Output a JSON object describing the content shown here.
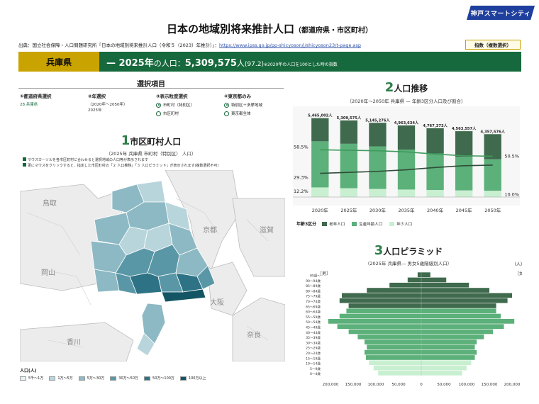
{
  "logo": "神戸スマートシティ",
  "title": "日本の地域別将来推計人口",
  "title_sub": "（都道府県・市区町村）",
  "source": {
    "text": "出典：国立社会保障・人口問題研究所「日本の地域別将来推計人口（令和５（2023）年推計）」：",
    "url": "https://www.ipss.go.jp/pp-shicyoson/j/shicyoson23/t-page.asp"
  },
  "metric_button": "指数（複数選択）",
  "banner": {
    "prefecture": "兵庫県",
    "year_label": "— 2025年",
    "pop_label": "の人口：",
    "population": "5,309,575",
    "unit": "人",
    "index": "(97.2)",
    "note": "※2020年の人口を100とした時の指数"
  },
  "selection": {
    "title": "選択項目",
    "col1": {
      "heading": "①都道府県選択",
      "value": "28.兵庫県"
    },
    "col2": {
      "heading": "②年選択",
      "sub": "（2020年～2050年）",
      "value": "2025年"
    },
    "col3": {
      "heading": "③表示粒度選択",
      "options": [
        "市町村（特別区）",
        "市区町村"
      ]
    },
    "col4": {
      "heading": "④東京都のみ",
      "options": [
        "特別区＋多摩地域",
        "東京都全体"
      ]
    }
  },
  "section1": {
    "num": "1",
    "title": "市区町村人口",
    "sub": "（2025年 兵庫県 市町村（特別区） 人口）",
    "note1": "マウスカーソルを各市区町村に合わせると選択地域の人口等が表示されます",
    "note2": "更にマウスをクリックすると、指定した市区町村の「２ 人口推移」「３ 人口ピラミッド」が表示されます(複数選択不可)",
    "map_labels": [
      "鳥取",
      "岡山",
      "京都",
      "滋賀",
      "大阪",
      "香川",
      "奈良"
    ],
    "legend_title": "人口(人)",
    "legend": [
      {
        "label": "5千～1万",
        "color": "#e6f1f3"
      },
      {
        "label": "1万～5万",
        "color": "#b9d5dc"
      },
      {
        "label": "5万～30万",
        "color": "#8db9c4"
      },
      {
        "label": "30万～50万",
        "color": "#5a97a6"
      },
      {
        "label": "50万～100万",
        "color": "#2e7385"
      },
      {
        "label": "100万以上",
        "color": "#145565"
      }
    ]
  },
  "section2": {
    "num": "2",
    "title": "人口推移",
    "sub": "（2020年～2050年 兵庫県 — 年齢3区分人口及び割合）",
    "legend_title": "年齢3区分",
    "legend": [
      {
        "label": "老年人口",
        "color": "#3f6a4d"
      },
      {
        "label": "生産年齢人口",
        "color": "#5cb07a"
      },
      {
        "label": "年少人口",
        "color": "#c9efd1"
      }
    ]
  },
  "section3": {
    "num": "3",
    "title": "人口ピラミッド",
    "sub": "（2025年 兵庫県— 男女5歳階級別人口）",
    "unit": "（人）",
    "male": "［男］",
    "female": "［女］"
  },
  "chart_data": [
    {
      "type": "bar",
      "categories": [
        "2020年",
        "2025年",
        "2030年",
        "2035年",
        "2040年",
        "2045年",
        "2050年"
      ],
      "totals_labels": [
        "5,465,002人",
        "5,309,575人",
        "5,145,276人",
        "4,963,634人",
        "4,767,373人",
        "4,563,557人",
        "4,357,576人"
      ],
      "totals": [
        5465002,
        5309575,
        5145276,
        4963634,
        4767373,
        4563557,
        4357576
      ],
      "series": [
        {
          "name": "年少人口",
          "values": [
            667000,
            612000,
            560000,
            520000,
            490000,
            463000,
            436000
          ]
        },
        {
          "name": "生産年齢人口",
          "values": [
            3197000,
            3080000,
            2950000,
            2770000,
            2530000,
            2330000,
            2180000
          ]
        },
        {
          "name": "老年人口",
          "values": [
            1601000,
            1617575,
            1635276,
            1673634,
            1747373,
            1770557,
            1741576
          ]
        }
      ],
      "ratio_labels": {
        "left_productive": "58.5%",
        "left_old": "29.3%",
        "left_young": "12.2%",
        "right_productive": "50.5%",
        "right_young": "10.0%"
      },
      "ratio_productive": [
        58.5,
        57.8,
        57.3,
        55.9,
        53.1,
        51.1,
        50.5
      ],
      "ratio_old": [
        29.3,
        30.5,
        31.8,
        33.7,
        36.6,
        38.8,
        39.5
      ]
    },
    {
      "type": "bar",
      "orientation": "horizontal-pyramid",
      "categories": [
        "0～4歳",
        "5～9歳",
        "10～14歳",
        "15～19歳",
        "20～24歳",
        "25～29歳",
        "30～34歳",
        "35～39歳",
        "40～44歳",
        "45～49歳",
        "50～54歳",
        "55～59歳",
        "60～64歳",
        "65～69歳",
        "70～74歳",
        "75～79歳",
        "80～84歳",
        "85～89歳",
        "90～94歳",
        "95歳～"
      ],
      "series": [
        {
          "name": "男",
          "values": [
            95000,
            105000,
            115000,
            122000,
            125000,
            120000,
            125000,
            140000,
            160000,
            185000,
            205000,
            180000,
            165000,
            160000,
            180000,
            175000,
            120000,
            70000,
            30000,
            8000
          ]
        },
        {
          "name": "女",
          "values": [
            90000,
            100000,
            110000,
            118000,
            122000,
            118000,
            122000,
            138000,
            158000,
            182000,
            205000,
            175000,
            165000,
            165000,
            190000,
            200000,
            150000,
            105000,
            55000,
            20000
          ]
        }
      ],
      "xticks": [
        "200,000",
        "150,000",
        "100,000",
        "50,000",
        "0",
        "50,000",
        "100,000",
        "150,000",
        "200,000"
      ],
      "xlim": [
        -200000,
        200000
      ]
    }
  ]
}
